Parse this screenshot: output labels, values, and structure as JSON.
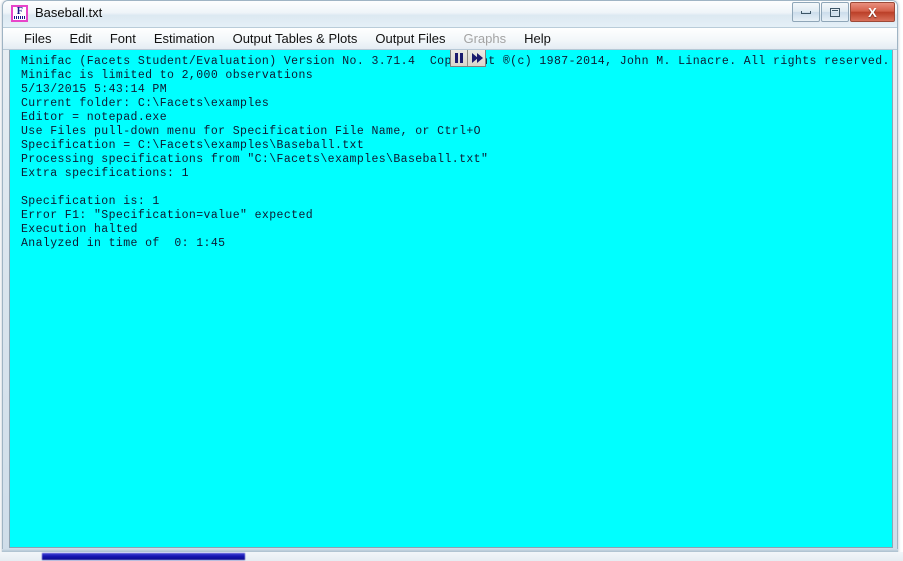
{
  "window": {
    "title": "Baseball.txt",
    "icon_name": "minifac-app-icon",
    "icon_glyph": "F"
  },
  "window_controls": {
    "minimize_label": "",
    "maximize_label": "",
    "close_label": "X"
  },
  "menubar": {
    "items": [
      {
        "label": "Files",
        "disabled": false
      },
      {
        "label": "Edit",
        "disabled": false
      },
      {
        "label": "Font",
        "disabled": false
      },
      {
        "label": "Estimation",
        "disabled": false
      },
      {
        "label": "Output Tables & Plots",
        "disabled": false
      },
      {
        "label": "Output Files",
        "disabled": false
      },
      {
        "label": "Graphs",
        "disabled": true
      },
      {
        "label": "Help",
        "disabled": false
      }
    ]
  },
  "transport": {
    "pause_name": "pause-button",
    "forward_name": "fast-forward-button"
  },
  "console": {
    "background_color": "#00FFFF",
    "text_color": "#0D1A33",
    "lines": [
      "Minifac (Facets Student/Evaluation) Version No. 3.71.4  Copyright ®(c) 1987-2014, John M. Linacre. All rights reserved.",
      "Minifac is limited to 2,000 observations",
      "5/13/2015 5:43:14 PM",
      "Current folder: C:\\Facets\\examples",
      "Editor = notepad.exe",
      "Use Files pull-down menu for Specification File Name, or Ctrl+O",
      "Specification = C:\\Facets\\examples\\Baseball.txt",
      "Processing specifications from \"C:\\Facets\\examples\\Baseball.txt\"",
      "Extra specifications: 1",
      "",
      "Specification is: 1",
      "Error F1: \"Specification=value\" expected",
      "Execution halted",
      "Analyzed in time of  0: 1:45"
    ]
  }
}
